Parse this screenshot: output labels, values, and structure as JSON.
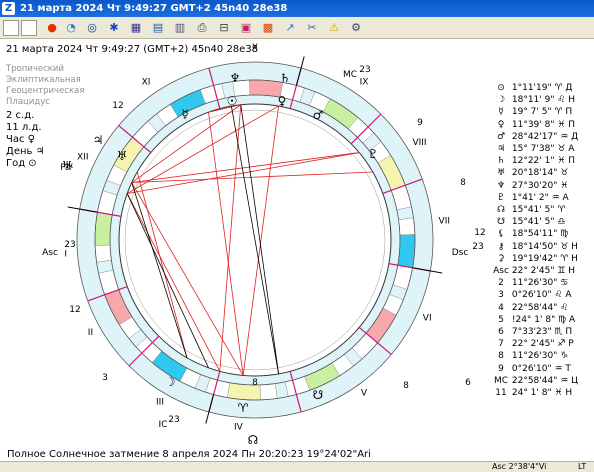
{
  "window": {
    "title": "21 марта 2024  Чт   9:49:27 GMT+2 45n40  28e38",
    "app_icon": "Z"
  },
  "header": {
    "line": "21 марта 2024  Чт   9:49:27 (GMT+2) 45n40  28e38"
  },
  "settings": [
    "Тропический",
    "Эклиптикальная",
    "Геоцентрическая",
    "Плацидус"
  ],
  "day_info": [
    "2 с.д.",
    "11 л.д.",
    "Час ♀",
    "День ♃",
    "Год ⊙"
  ],
  "houses": {
    "roman": [
      "X",
      "IX",
      "VIII",
      "VII",
      "VI",
      "V",
      "IV",
      "III",
      "II",
      "I",
      "XII",
      "XI"
    ],
    "asc": "Asc",
    "dsc": "Dsc",
    "mc": "MC",
    "ic": "IC",
    "asc_deg": "23",
    "dsc_deg": "23",
    "mc_deg": "23",
    "ic_deg": "23"
  },
  "cusp_degrees": [
    "9",
    "8",
    "12",
    "6",
    "8",
    "3",
    "12",
    "12",
    "8"
  ],
  "chart_labels": {
    "top_planets": [
      "19",
      "16",
      "28",
      "13",
      "20",
      "29"
    ],
    "left_planets": [
      "19",
      "21",
      "16"
    ],
    "bottom_planets": [
      "19",
      "19",
      "25"
    ],
    "right_planets": [
      "2"
    ],
    "node_label": "☊☋",
    "retro": "P♅",
    "ic_bottom": "♁♈"
  },
  "planets": [
    {
      "sym": "⊙",
      "pos": "1°11'19\" ♈ Д"
    },
    {
      "sym": "☽",
      "pos": "18°11' 9\" ♌ Н"
    },
    {
      "sym": "☿",
      "pos": "19° 7' 5\" ♈ П"
    },
    {
      "sym": "♀",
      "pos": "11°39' 8\" ♓ П"
    },
    {
      "sym": "♂",
      "pos": "28°42'17\" ♒ Д"
    },
    {
      "sym": "♃",
      "pos": "15° 7'38\" ♉ А"
    },
    {
      "sym": "♄",
      "pos": "12°22' 1\" ♓ П"
    },
    {
      "sym": "♅",
      "pos": "20°18'14\" ♉"
    },
    {
      "sym": "♆",
      "pos": "27°30'20\" ♓"
    },
    {
      "sym": "♇",
      "pos": "1°41' 2\" ♒ А"
    },
    {
      "sym": "☊",
      "pos": "15°41' 5\" ♈"
    },
    {
      "sym": "☋",
      "pos": "15°41' 5\" ♎"
    },
    {
      "sym": "⚸",
      "pos": "18°54'11\" ♍"
    },
    {
      "sym": "⚷",
      "pos": "18°14'50\" ♉ Н"
    },
    {
      "sym": "⚳",
      "pos": "19°19'42\" ♈ Н"
    },
    {
      "sym": "Asc",
      "pos": "22° 2'45\" ♊ Н"
    },
    {
      "sym": "2",
      "pos": "11°26'30\" ♋"
    },
    {
      "sym": "3",
      "pos": "0°26'10\" ♌ А"
    },
    {
      "sym": "4",
      "pos": "22°58'44\" ♌"
    },
    {
      "sym": "5",
      "pos": "!24° 1' 8\" ♍ А"
    },
    {
      "sym": "6",
      "pos": "7°33'23\" ♏ П"
    },
    {
      "sym": "7",
      "pos": "22° 2'45\" ♐ Р"
    },
    {
      "sym": "8",
      "pos": "11°26'30\" ♑"
    },
    {
      "sym": "9",
      "pos": "0°26'10\" ♒ Т"
    },
    {
      "sym": "MC",
      "pos": "22°58'44\" ♒ Ц"
    },
    {
      "sym": "11",
      "pos": "24° 1' 8\" ♓ Н"
    }
  ],
  "eclipse": "Полное Солнечное затмение  8 апреля 2024 Пн 20:20:23 19°24'02\"Ari",
  "status": {
    "left": "",
    "asc": "Asc  2°38'4\"Vi",
    "lt": "LT"
  },
  "colors": {
    "titlebar": "#0a58c9",
    "ring_fire": "#f6a8ac",
    "ring_earth": "#c8f0a0",
    "ring_air": "#f4f4b0",
    "ring_water": "#30c8f0",
    "cusp": "#d0147c",
    "aspect_red": "#e02020",
    "aspect_black": "#000000"
  },
  "toolbar_icons": [
    "new-icon",
    "open-icon",
    "stop-icon",
    "chart-icon",
    "planet-icon",
    "star-icon",
    "calendar-icon",
    "grid-icon",
    "table-icon",
    "print-icon",
    "clock-icon",
    "aspect-icon",
    "wheel-icon",
    "tools-icon",
    "warning-icon",
    "settings-icon"
  ]
}
